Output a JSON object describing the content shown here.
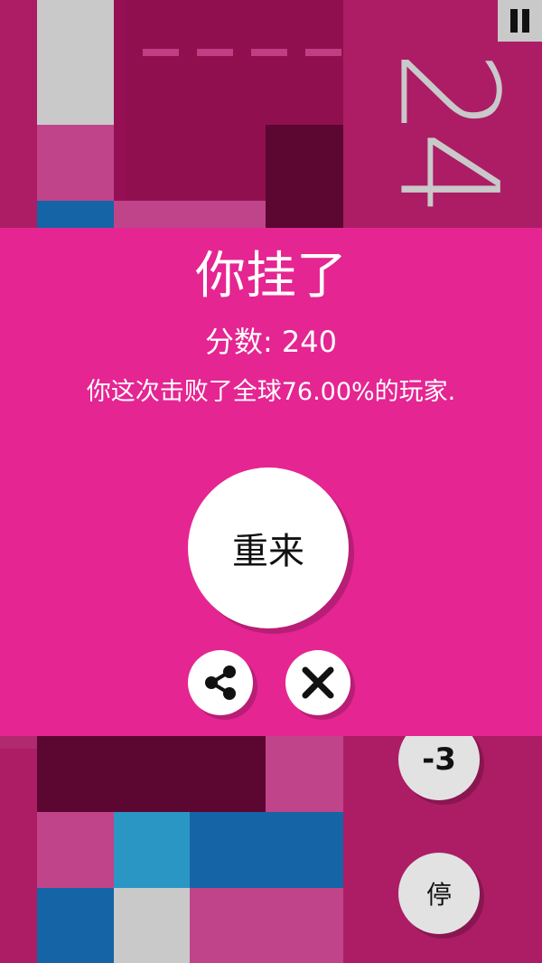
{
  "game": {
    "current_score": "24",
    "minus_label": "-3",
    "stop_label": "停"
  },
  "dialog": {
    "title": "你挂了",
    "score_text": "分数: 240",
    "beat_text": "你这次击败了全球76.00%的玩家.",
    "retry_label": "重来"
  },
  "icons": {
    "pause": "pause-icon",
    "share": "share-icon",
    "close": "close-icon"
  },
  "colors": {
    "overlay": "#e52592",
    "board_bg": "#a81c63",
    "dark_block": "#5c0632",
    "light_gray": "#c9c9c9",
    "blue": "#1464a6",
    "light_blue": "#2a96c4",
    "pink_block": "#c0448a"
  }
}
